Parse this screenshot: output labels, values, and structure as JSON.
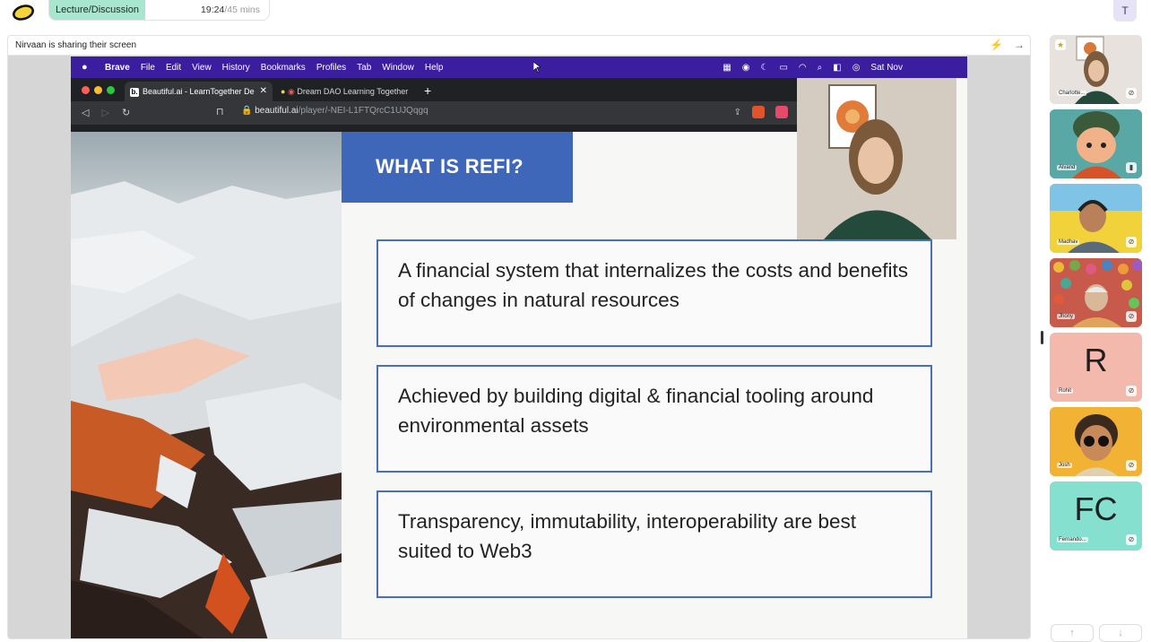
{
  "session": {
    "label": "Lecture/Discussion",
    "elapsed": "19:24",
    "separator": "/",
    "total": "45 mins",
    "user_initial": "T"
  },
  "share": {
    "status": "Nirvaan is sharing their screen",
    "actions": [
      "⚡",
      "→"
    ]
  },
  "mac_menu": {
    "items": [
      "Brave",
      "File",
      "Edit",
      "View",
      "History",
      "Bookmarks",
      "Profiles",
      "Tab",
      "Window",
      "Help"
    ],
    "clock": "Sat Nov"
  },
  "browser": {
    "tabs": [
      {
        "label": "Beautiful.ai - LearnTogether De",
        "favicon": "b.",
        "active": true
      },
      {
        "label": "Dream DAO Learning Together",
        "active": false
      }
    ],
    "new_tab": "+",
    "url_host": "beautiful.ai",
    "url_path": "/player/-NEI-L1FTQrcC1UJQqgq"
  },
  "slide": {
    "title": "WHAT IS REFI?",
    "cards": [
      "A financial system that internalizes the costs and benefits of changes in natural resources",
      "Achieved by building digital & financial tooling around environmental assets",
      "Transparency, immutability, interoperability are best suited to Web3"
    ]
  },
  "participants": [
    {
      "name": "Charlotte...",
      "type": "video",
      "bg": "#d8cfc8",
      "starred": true
    },
    {
      "name": "Alvand",
      "type": "video",
      "bg": "#c96a4f"
    },
    {
      "name": "Madhav",
      "type": "video",
      "bg": "#7fc3e6"
    },
    {
      "name": "Jhony",
      "type": "video",
      "bg": "#e0a35a"
    },
    {
      "name": "Rohit",
      "type": "initials",
      "initials": "R",
      "bg": "#f4b9ad"
    },
    {
      "name": "Josh",
      "type": "video",
      "bg": "#f2b233"
    },
    {
      "name": "Fernando...",
      "type": "initials",
      "initials": "FC",
      "bg": "#86e0d0"
    }
  ],
  "scroll": {
    "up": "↑",
    "down": "↓"
  }
}
